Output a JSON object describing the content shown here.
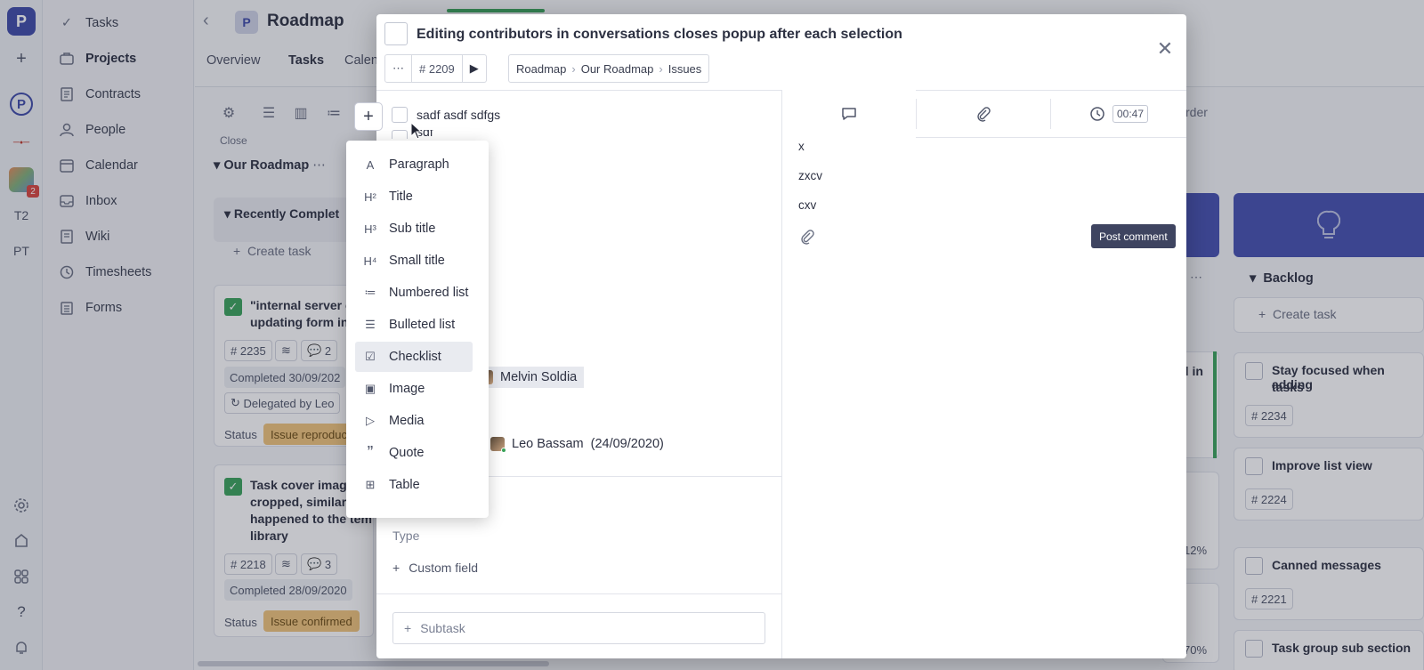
{
  "app": {
    "logo_letter": "P",
    "rail_items": [
      "T2",
      "PT"
    ],
    "team_badge": "2"
  },
  "nav": {
    "items": [
      {
        "label": "Tasks",
        "icon": "check-icon"
      },
      {
        "label": "Projects",
        "icon": "briefcase-icon",
        "active": true
      },
      {
        "label": "Contracts",
        "icon": "document-icon"
      },
      {
        "label": "People",
        "icon": "person-icon"
      },
      {
        "label": "Calendar",
        "icon": "calendar-icon"
      },
      {
        "label": "Inbox",
        "icon": "inbox-icon"
      },
      {
        "label": "Wiki",
        "icon": "wiki-icon"
      },
      {
        "label": "Timesheets",
        "icon": "clock-icon"
      },
      {
        "label": "Forms",
        "icon": "clipboard-icon"
      }
    ]
  },
  "header": {
    "title": "Roadmap",
    "project_letter": "P",
    "tabs": [
      "Overview",
      "Tasks",
      "Calen"
    ],
    "close_label": "Close",
    "order_label": "rder"
  },
  "board": {
    "group_title": "Our Roadmap",
    "section_title": "Recently Complet",
    "create_task": "Create task",
    "cards": [
      {
        "title_line1": "\"internal server e",
        "title_line2": "updating form in",
        "id": "# 2235",
        "comments": "2",
        "completed": "Completed 30/09/202",
        "delegated": "Delegated by Leo",
        "status_label": "Status",
        "status": "Issue reproduc"
      },
      {
        "title_line1": "Task cover image",
        "title_line2": "cropped, similar t",
        "title_line3": "happened to the tem",
        "title_line4": "library",
        "id": "# 2218",
        "comments": "3",
        "completed": "Completed 28/09/2020",
        "status_label": "Status",
        "status": "Issue confirmed"
      }
    ],
    "middle_fragments": [
      "d in",
      "12%",
      "70%"
    ],
    "backlog": {
      "title": "Backlog",
      "create_task": "Create task",
      "cards": [
        {
          "title_line1": "Stay focused when adding",
          "title_line2": "tasks",
          "id": "# 2234"
        },
        {
          "title_line1": "Improve list view",
          "id": "# 2224"
        },
        {
          "title_line1": "Canned messages",
          "id": "# 2221"
        },
        {
          "title_line1": "Task group sub section"
        }
      ]
    }
  },
  "modal": {
    "title": "Editing contributors in conversations closes popup after each selection",
    "more": "⋯",
    "task_id": "# 2209",
    "breadcrumb": [
      "Roadmap",
      "Our Roadmap",
      "Issues"
    ],
    "checklist": [
      "sadf asdf sdfgs",
      "sdf"
    ],
    "assignee": "Melvin Soldia",
    "creator": "Leo Bassam",
    "created_date": "(24/09/2020)",
    "type_label": "Type",
    "custom_field": "Custom field",
    "subtask": "Subtask",
    "timer": "00:47",
    "comments": [
      "x",
      "zxcv",
      "cxv"
    ],
    "post_comment": "Post comment"
  },
  "menu": {
    "items": [
      {
        "label": "Paragraph",
        "icon": "paragraph-icon",
        "glyph": "A"
      },
      {
        "label": "Title",
        "icon": "h2-icon",
        "glyph": "H²"
      },
      {
        "label": "Sub title",
        "icon": "h3-icon",
        "glyph": "H³"
      },
      {
        "label": "Small title",
        "icon": "h4-icon",
        "glyph": "H⁴"
      },
      {
        "label": "Numbered list",
        "icon": "numbered-list-icon",
        "glyph": "≔"
      },
      {
        "label": "Bulleted list",
        "icon": "bulleted-list-icon",
        "glyph": "☰"
      },
      {
        "label": "Checklist",
        "icon": "checklist-icon",
        "glyph": "☑",
        "highlighted": true
      },
      {
        "label": "Image",
        "icon": "image-icon",
        "glyph": "▣"
      },
      {
        "label": "Media",
        "icon": "media-icon",
        "glyph": "▷"
      },
      {
        "label": "Quote",
        "icon": "quote-icon",
        "glyph": "”"
      },
      {
        "label": "Table",
        "icon": "table-icon",
        "glyph": "⊞"
      }
    ]
  },
  "colors": {
    "brand": "#3d4aa8",
    "success": "#3aa35a",
    "status_orange": "#f0c47a",
    "button_dark": "#3e4460"
  }
}
